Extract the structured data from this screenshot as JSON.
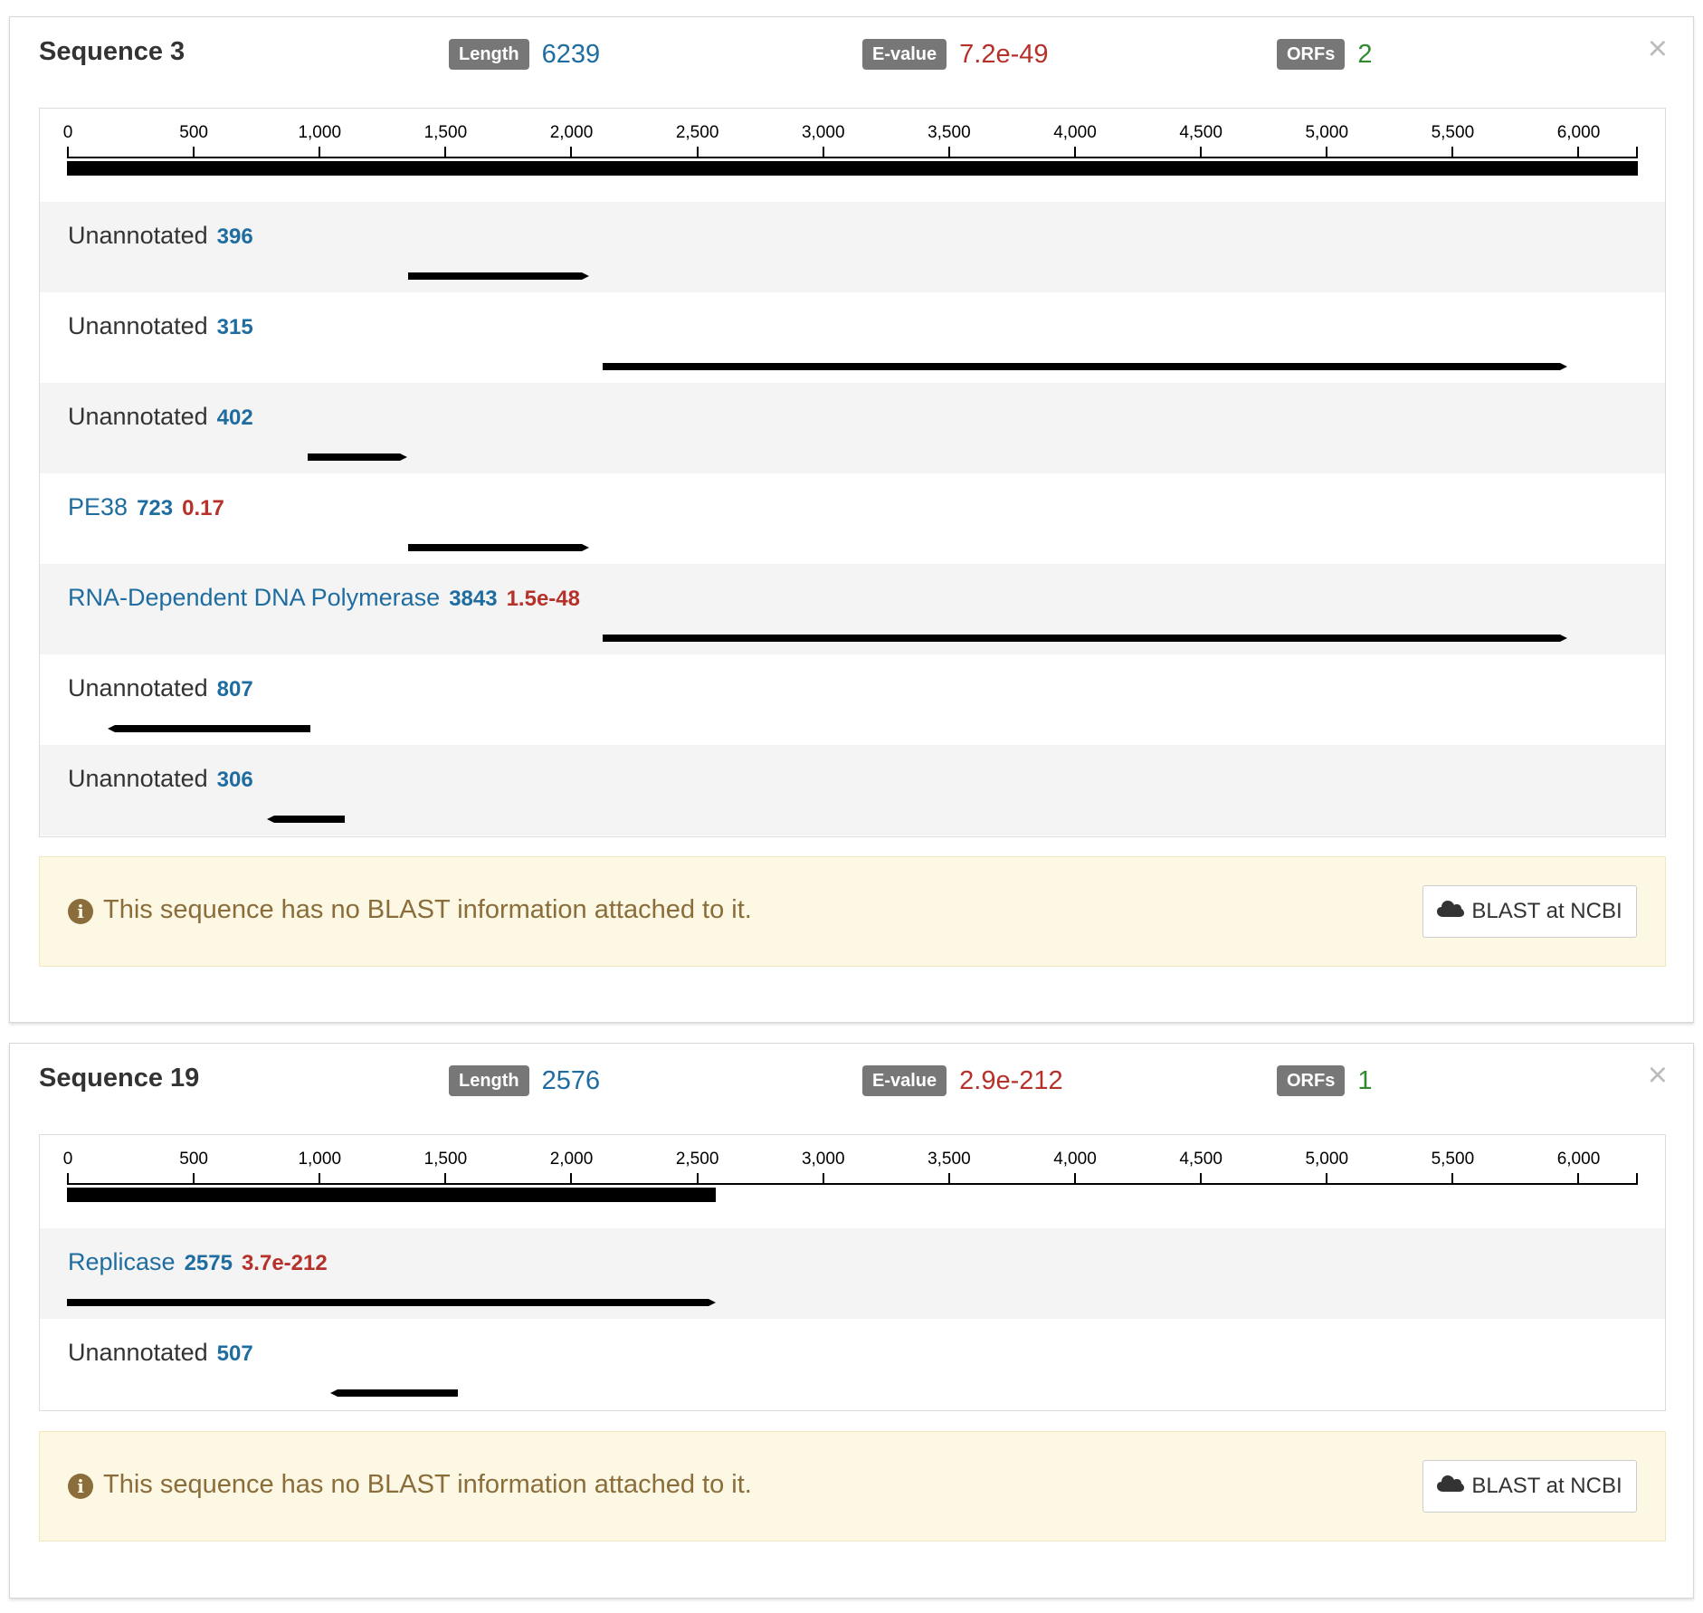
{
  "sequences": [
    {
      "title": "Sequence 3",
      "length_label": "Length",
      "length": "6239",
      "evalue_label": "E-value",
      "evalue": "7.2e-49",
      "orfs_label": "ORFs",
      "orfs": "2",
      "close_glyph": "×",
      "seq_length_bp": 6239,
      "orf_list": [
        {
          "name": "Unannotated",
          "annotated": false,
          "length": "396",
          "evalue": "",
          "start": 1355,
          "end": 2073,
          "strand": "+"
        },
        {
          "name": "Unannotated",
          "annotated": false,
          "length": "315",
          "evalue": "",
          "start": 2127,
          "end": 5960,
          "strand": "+"
        },
        {
          "name": "Unannotated",
          "annotated": false,
          "length": "402",
          "evalue": "",
          "start": 955,
          "end": 1350,
          "strand": "+"
        },
        {
          "name": "PE38",
          "annotated": true,
          "length": "723",
          "evalue": "0.17",
          "start": 1355,
          "end": 2073,
          "strand": "+"
        },
        {
          "name": "RNA-Dependent DNA Polymerase",
          "annotated": true,
          "length": "3843",
          "evalue": "1.5e-48",
          "start": 2127,
          "end": 5960,
          "strand": "+"
        },
        {
          "name": "Unannotated",
          "annotated": false,
          "length": "807",
          "evalue": "",
          "start": 160,
          "end": 967,
          "strand": "-"
        },
        {
          "name": "Unannotated",
          "annotated": false,
          "length": "306",
          "evalue": "",
          "start": 796,
          "end": 1102,
          "strand": "-"
        }
      ],
      "alert_text": "This sequence has no BLAST information attached to it.",
      "blast_button": "BLAST at NCBI"
    },
    {
      "title": "Sequence 19",
      "length_label": "Length",
      "length": "2576",
      "evalue_label": "E-value",
      "evalue": "2.9e-212",
      "orfs_label": "ORFs",
      "orfs": "1",
      "close_glyph": "×",
      "seq_length_bp": 2576,
      "orf_list": [
        {
          "name": "Replicase",
          "annotated": true,
          "length": "2575",
          "evalue": "3.7e-212",
          "start": 0,
          "end": 2576,
          "strand": "+"
        },
        {
          "name": "Unannotated",
          "annotated": false,
          "length": "507",
          "evalue": "",
          "start": 1045,
          "end": 1552,
          "strand": "-"
        }
      ],
      "alert_text": "This sequence has no BLAST information attached to it.",
      "blast_button": "BLAST at NCBI"
    }
  ],
  "ruler": {
    "max": 6239,
    "ticks": [
      "0",
      "500",
      "1,000",
      "1,500",
      "2,000",
      "2,500",
      "3,000",
      "3,500",
      "4,000",
      "4,500",
      "5,000",
      "5,500",
      "6,000"
    ],
    "tick_values": [
      0,
      500,
      1000,
      1500,
      2000,
      2500,
      3000,
      3500,
      4000,
      4500,
      5000,
      5500,
      6000
    ]
  },
  "colors": {
    "accent_blue": "#1f6da0",
    "evalue_red": "#b5312a",
    "orfs_green": "#2f8a2f",
    "alert_bg": "#fcf8e3",
    "alert_text": "#8a6d3b"
  },
  "icons": {
    "alert": "info-circle-icon",
    "button": "cloud-icon",
    "close": "close-icon"
  }
}
